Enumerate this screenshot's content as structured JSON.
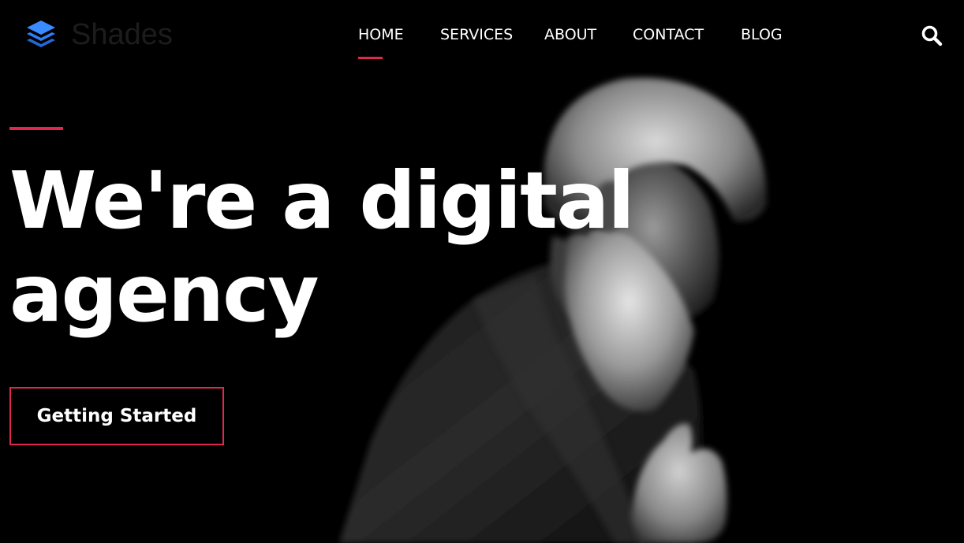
{
  "brand": {
    "name": "Shades",
    "logo_icon": "stacked-layers-icon",
    "logo_color": "#2d7ff9"
  },
  "nav": {
    "items": [
      {
        "label": "HOME",
        "active": true
      },
      {
        "label": "SERVICES",
        "active": false
      },
      {
        "label": "ABOUT",
        "active": false
      },
      {
        "label": "CONTACT",
        "active": false
      },
      {
        "label": "BLOG",
        "active": false
      }
    ],
    "search_icon": "search-icon"
  },
  "hero": {
    "headline": "We're a digital agency",
    "cta_label": "Getting Started",
    "background_image": "bearded-man-portrait-photo"
  },
  "colors": {
    "accent": "#e0284f",
    "background": "#000000",
    "text": "#ffffff"
  }
}
